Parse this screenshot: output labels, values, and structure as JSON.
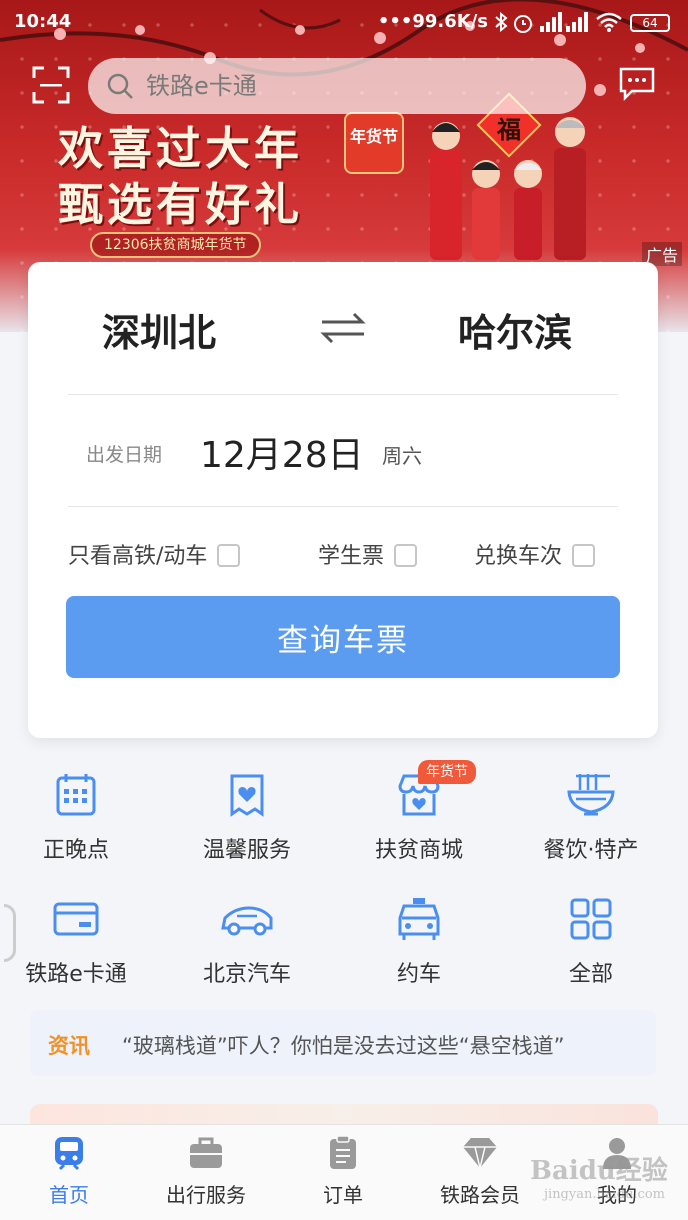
{
  "status_bar": {
    "time": "10:44",
    "net_speed": "99.6K/s",
    "battery": "64"
  },
  "search": {
    "placeholder": "铁路e卡通"
  },
  "banner": {
    "title_line1": "欢喜过大年",
    "title_line2": "甄选有好礼",
    "subtitle": "12306扶贫商城年货节",
    "seal": "年货节",
    "fu": "福",
    "ad_label": "广告"
  },
  "query": {
    "from_station": "深圳北",
    "to_station": "哈尔滨",
    "date_label": "出发日期",
    "date_value": "12月28日",
    "weekday": "周六",
    "options": [
      {
        "label": "只看高铁/动车",
        "checked": false
      },
      {
        "label": "学生票",
        "checked": false
      },
      {
        "label": "兑换车次",
        "checked": false
      }
    ],
    "button": "查询车票"
  },
  "services": [
    {
      "label": "正晚点",
      "icon": "calendar-icon"
    },
    {
      "label": "温馨服务",
      "icon": "heart-bag-icon"
    },
    {
      "label": "扶贫商城",
      "icon": "shop-icon",
      "badge": "年货节"
    },
    {
      "label": "餐饮·特产",
      "icon": "noodle-bowl-icon"
    },
    {
      "label": "铁路e卡通",
      "icon": "card-icon"
    },
    {
      "label": "北京汽车",
      "icon": "car-icon"
    },
    {
      "label": "约车",
      "icon": "taxi-icon"
    },
    {
      "label": "全部",
      "icon": "grid-icon"
    }
  ],
  "news": {
    "tag": "资讯",
    "text": "“玻璃栈道”吓人？你怕是没去过这些“悬空栈道”"
  },
  "tabs": [
    {
      "label": "首页",
      "icon": "train-icon",
      "active": true
    },
    {
      "label": "出行服务",
      "icon": "briefcase-icon",
      "active": false
    },
    {
      "label": "订单",
      "icon": "order-icon",
      "active": false
    },
    {
      "label": "铁路会员",
      "icon": "diamond-icon",
      "active": false
    },
    {
      "label": "我的",
      "icon": "user-icon",
      "active": false
    }
  ],
  "watermark": {
    "brand": "Baidu经验",
    "url": "jingyan.baidu.com"
  }
}
